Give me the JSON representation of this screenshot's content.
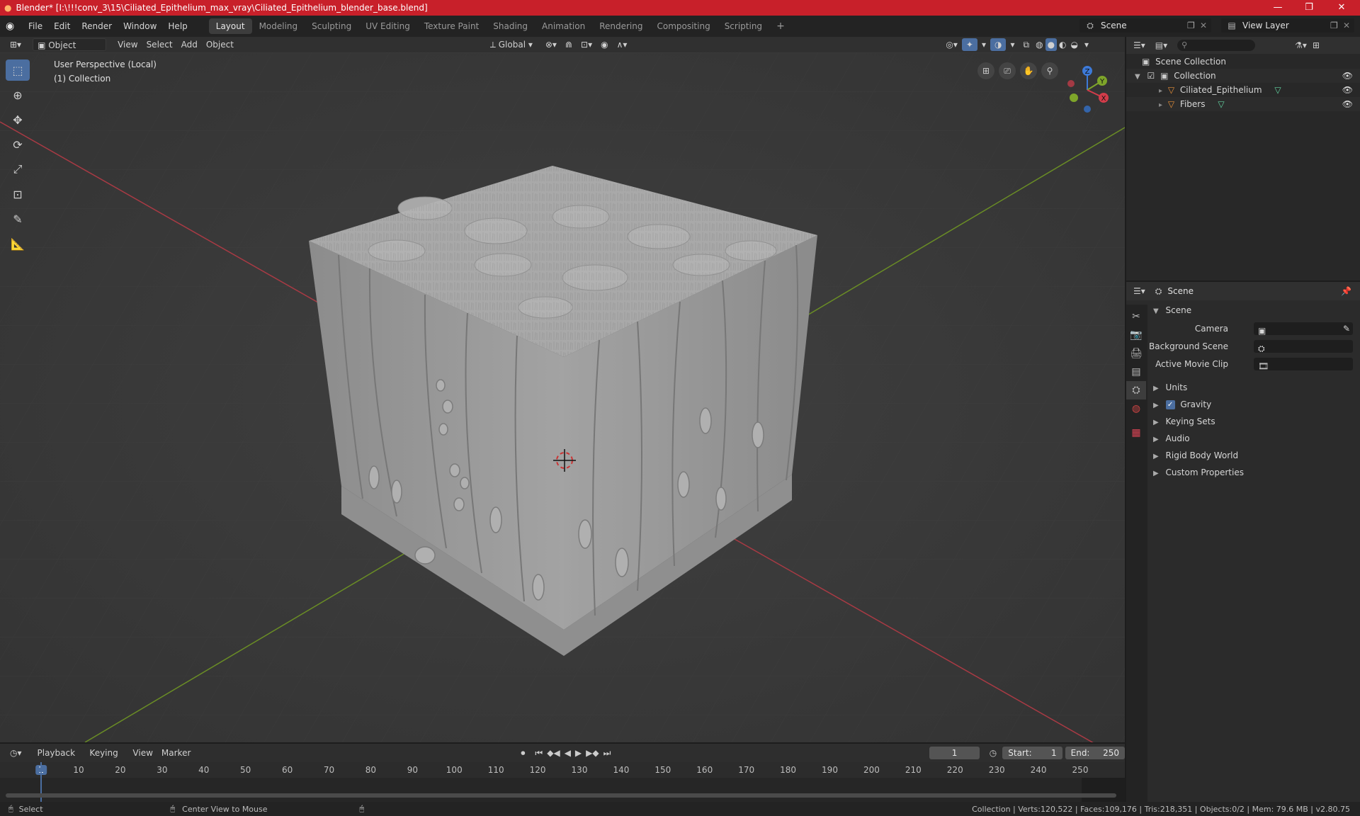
{
  "titlebar": {
    "title": "Blender* [I:\\!!!conv_3\\15\\Ciliated_Epithelium_max_vray\\Ciliated_Epithelium_blender_base.blend]",
    "minimize": "—",
    "maximize": "❐",
    "close": "✕"
  },
  "menus": [
    "File",
    "Edit",
    "Render",
    "Window",
    "Help"
  ],
  "workspaces": [
    "Layout",
    "Modeling",
    "Sculpting",
    "UV Editing",
    "Texture Paint",
    "Shading",
    "Animation",
    "Rendering",
    "Compositing",
    "Scripting"
  ],
  "active_workspace": "Layout",
  "scene_selector": "Scene",
  "view_layer_selector": "View Layer",
  "viewport_header": {
    "mode": "Object Mode",
    "view": "View",
    "select": "Select",
    "add": "Add",
    "object": "Object",
    "orientation": "Global"
  },
  "viewport_overlay": {
    "perspective": "User Perspective (Local)",
    "collection": "(1) Collection"
  },
  "gizmo": {
    "x": "X",
    "y": "Y",
    "z": "Z"
  },
  "outliner": {
    "root": "Scene Collection",
    "items": [
      {
        "name": "Collection",
        "level": 1
      },
      {
        "name": "Ciliated_Epithelium",
        "level": 2
      },
      {
        "name": "Fibers",
        "level": 2
      }
    ]
  },
  "properties": {
    "header": "Scene",
    "panel": "Scene",
    "fields": [
      {
        "label": "Camera"
      },
      {
        "label": "Background Scene"
      },
      {
        "label": "Active Movie Clip"
      }
    ],
    "sections": [
      {
        "label": "Units",
        "checkbox": false
      },
      {
        "label": "Gravity",
        "checkbox": true
      },
      {
        "label": "Keying Sets",
        "checkbox": false
      },
      {
        "label": "Audio",
        "checkbox": false
      },
      {
        "label": "Rigid Body World",
        "checkbox": false
      },
      {
        "label": "Custom Properties",
        "checkbox": false
      }
    ]
  },
  "timeline": {
    "playback": "Playback",
    "keying": "Keying",
    "view": "View",
    "marker": "Marker",
    "current_frame": "1",
    "start_label": "Start:",
    "start": "1",
    "end_label": "End:",
    "end": "250",
    "ticks": [
      "1",
      "10",
      "20",
      "30",
      "40",
      "50",
      "60",
      "70",
      "80",
      "90",
      "100",
      "110",
      "120",
      "130",
      "140",
      "150",
      "160",
      "170",
      "180",
      "190",
      "200",
      "210",
      "220",
      "230",
      "240",
      "250"
    ]
  },
  "statusbar": {
    "select": "Select",
    "center": "Center View to Mouse",
    "stats": "Collection | Verts:120,522 | Faces:109,176 | Tris:218,351 | Objects:0/2 | Mem: 79.6 MB | v2.80.75"
  },
  "colors": {
    "title_bar": "#c8202a",
    "accent": "#4b6ea0",
    "x_axis": "#d33c4a",
    "y_axis": "#7ea52a",
    "z_axis": "#3d7ad8"
  }
}
